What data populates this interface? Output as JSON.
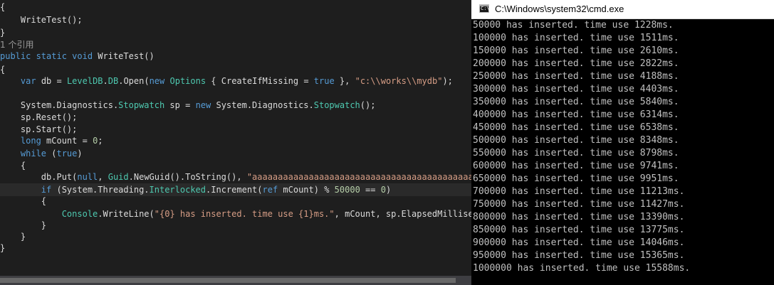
{
  "editor": {
    "lines": [
      [
        {
          "t": "{",
          "c": "tx"
        }
      ],
      [
        {
          "t": "    WriteTest();",
          "c": "tx"
        }
      ],
      [
        {
          "t": "}",
          "c": "tx"
        }
      ],
      [
        {
          "t": "1 个引用",
          "c": "codelens"
        }
      ],
      [
        {
          "t": "public static void",
          "c": "kw"
        },
        {
          "t": " WriteTest()",
          "c": "tx"
        }
      ],
      [
        {
          "t": "{",
          "c": "tx"
        }
      ],
      [
        {
          "t": "    ",
          "c": "tx"
        },
        {
          "t": "var",
          "c": "kw"
        },
        {
          "t": " db = ",
          "c": "tx"
        },
        {
          "t": "LevelDB",
          "c": "ty"
        },
        {
          "t": ".",
          "c": "tx"
        },
        {
          "t": "DB",
          "c": "ty"
        },
        {
          "t": ".Open(",
          "c": "tx"
        },
        {
          "t": "new",
          "c": "kw"
        },
        {
          "t": " ",
          "c": "tx"
        },
        {
          "t": "Options",
          "c": "ty"
        },
        {
          "t": " { CreateIfMissing = ",
          "c": "tx"
        },
        {
          "t": "true",
          "c": "kw"
        },
        {
          "t": " }, ",
          "c": "tx"
        },
        {
          "t": "\"c:\\\\works\\\\mydb\"",
          "c": "st"
        },
        {
          "t": ");",
          "c": "tx"
        }
      ],
      [
        {
          "t": "",
          "c": "tx"
        }
      ],
      [
        {
          "t": "    System.Diagnostics.",
          "c": "tx"
        },
        {
          "t": "Stopwatch",
          "c": "ty"
        },
        {
          "t": " sp = ",
          "c": "tx"
        },
        {
          "t": "new",
          "c": "kw"
        },
        {
          "t": " System.Diagnostics.",
          "c": "tx"
        },
        {
          "t": "Stopwatch",
          "c": "ty"
        },
        {
          "t": "();",
          "c": "tx"
        }
      ],
      [
        {
          "t": "    sp.Reset();",
          "c": "tx"
        }
      ],
      [
        {
          "t": "    sp.Start();",
          "c": "tx"
        }
      ],
      [
        {
          "t": "    ",
          "c": "tx"
        },
        {
          "t": "long",
          "c": "kw"
        },
        {
          "t": " mCount = ",
          "c": "tx"
        },
        {
          "t": "0",
          "c": "nm"
        },
        {
          "t": ";",
          "c": "tx"
        }
      ],
      [
        {
          "t": "    ",
          "c": "tx"
        },
        {
          "t": "while",
          "c": "kw"
        },
        {
          "t": " (",
          "c": "tx"
        },
        {
          "t": "true",
          "c": "kw"
        },
        {
          "t": ")",
          "c": "tx"
        }
      ],
      [
        {
          "t": "    {",
          "c": "tx"
        }
      ],
      [
        {
          "t": "        db.Put(",
          "c": "tx"
        },
        {
          "t": "null",
          "c": "kw"
        },
        {
          "t": ", ",
          "c": "tx"
        },
        {
          "t": "Guid",
          "c": "ty"
        },
        {
          "t": ".NewGuid().ToString(), ",
          "c": "tx"
        },
        {
          "t": "\"aaaaaaaaaaaaaaaaaaaaaaaaaaaaaaaaaaaaaaaaaaaaaaaaaaaaaaaaaaaa",
          "c": "st"
        }
      ],
      [
        {
          "t": "        ",
          "c": "tx"
        },
        {
          "t": "if",
          "c": "kw"
        },
        {
          "t": " (System.Threading.",
          "c": "tx"
        },
        {
          "t": "Interlocked",
          "c": "ty"
        },
        {
          "t": ".Increment(",
          "c": "tx"
        },
        {
          "t": "ref",
          "c": "kw"
        },
        {
          "t": " mCount) % ",
          "c": "tx"
        },
        {
          "t": "50000",
          "c": "nm"
        },
        {
          "t": " == ",
          "c": "tx"
        },
        {
          "t": "0",
          "c": "nm"
        },
        {
          "t": ")",
          "c": "tx"
        }
      ],
      [
        {
          "t": "        {",
          "c": "tx"
        }
      ],
      [
        {
          "t": "            ",
          "c": "tx"
        },
        {
          "t": "Console",
          "c": "ty"
        },
        {
          "t": ".WriteLine(",
          "c": "tx"
        },
        {
          "t": "\"{0} has inserted. time use {1}ms.\"",
          "c": "st"
        },
        {
          "t": ", mCount, sp.ElapsedMilliseconds",
          "c": "tx"
        }
      ],
      [
        {
          "t": "        }",
          "c": "tx"
        }
      ],
      [
        {
          "t": "    }",
          "c": "tx"
        }
      ],
      [
        {
          "t": "}",
          "c": "tx"
        }
      ]
    ]
  },
  "console": {
    "title": "C:\\Windows\\system32\\cmd.exe",
    "icon": "cmd-window-icon",
    "icon_text": "C:\\",
    "lines": [
      "50000 has inserted. time use 1228ms.",
      "100000 has inserted. time use 1511ms.",
      "150000 has inserted. time use 2610ms.",
      "200000 has inserted. time use 2822ms.",
      "250000 has inserted. time use 4188ms.",
      "300000 has inserted. time use 4403ms.",
      "350000 has inserted. time use 5840ms.",
      "400000 has inserted. time use 6314ms.",
      "450000 has inserted. time use 6538ms.",
      "500000 has inserted. time use 8348ms.",
      "550000 has inserted. time use 8798ms.",
      "600000 has inserted. time use 9741ms.",
      "650000 has inserted. time use 9951ms.",
      "700000 has inserted. time use 11213ms.",
      "750000 has inserted. time use 11427ms.",
      "800000 has inserted. time use 13390ms.",
      "850000 has inserted. time use 13775ms.",
      "900000 has inserted. time use 14046ms.",
      "950000 has inserted. time use 15365ms.",
      "1000000 has inserted. time use 15588ms."
    ]
  },
  "colors": {
    "editor_bg": "#1e1e1e",
    "keyword": "#569cd6",
    "type": "#4ec9b0",
    "string": "#d69d85",
    "number": "#b5cea8",
    "console_bg": "#000000",
    "console_text": "#c0c0c0"
  }
}
